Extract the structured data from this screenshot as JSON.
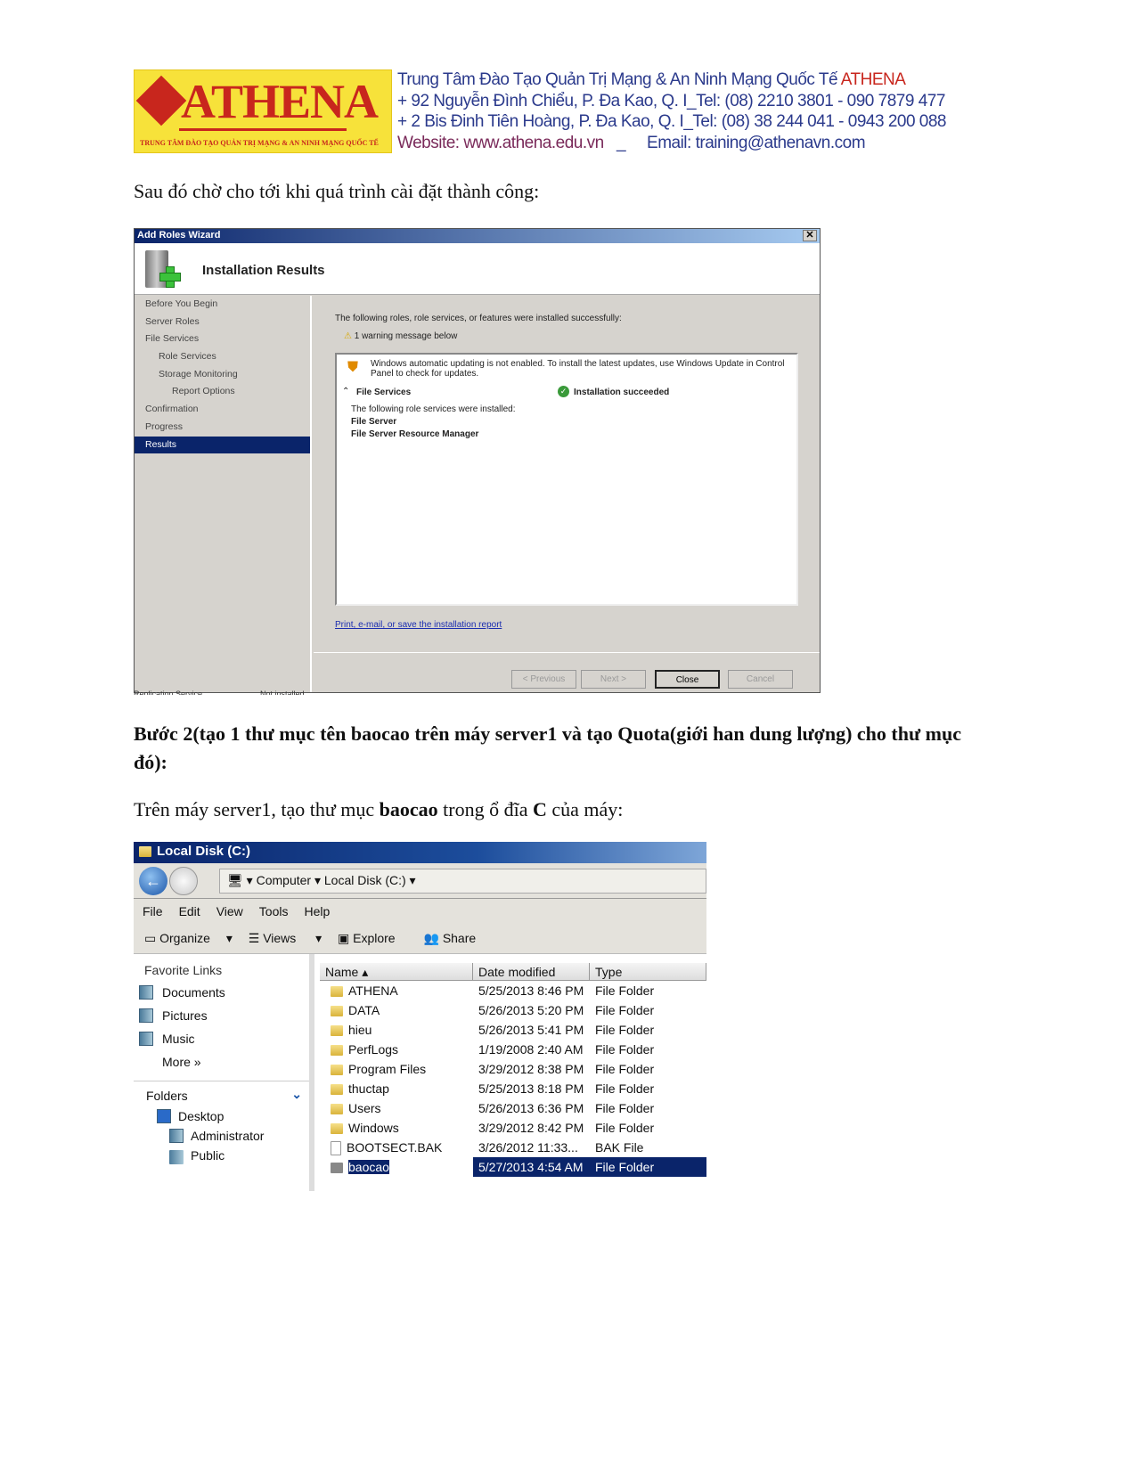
{
  "header": {
    "logo_text": "ATHENA",
    "logo_subtitle": "TRUNG TÂM ĐÀO TẠO QUẢN TRỊ MẠNG & AN NINH MẠNG QUỐC TẾ",
    "line1": "Trung Tâm Đào Tạo Quản Trị Mạng & An Ninh Mạng Quốc Tế ",
    "line1_brand": "ATHENA",
    "line2": "+ 92 Nguyễn Đình Chiểu, P. Đa Kao, Q. I_Tel: (08) 2210 3801 - 090 7879 477",
    "line3": "+ 2 Bis Đinh Tiên Hoàng, P. Đa Kao, Q. I_Tel: (08) 38 244 041 - 0943 200 088",
    "website": "Website: www.athena.edu.vn",
    "sep": "_",
    "email": "Email: training@athenavn.com",
    "colors": {
      "brand_red": "#c8261d",
      "logo_yellow": "#f7e23a",
      "text_blue": "#2b3a8c"
    }
  },
  "para1": "Sau đó chờ cho tới khi quá trình cài đặt thành công:",
  "wizard": {
    "title": "Add Roles Wizard",
    "close": "✕",
    "heading": "Installation Results",
    "nav": [
      "Before You Begin",
      "Server Roles",
      "File Services",
      "Role Services",
      "Storage Monitoring",
      "Report Options",
      "Confirmation",
      "Progress",
      "Results"
    ],
    "selected": "Results",
    "intro": "The following roles, role services, or features were installed successfully:",
    "warning_count": "1 warning message below",
    "warning": "Windows automatic updating is not enabled. To install the latest updates, use Windows Update in Control Panel to check for updates.",
    "section": "File Services",
    "status": "Installation succeeded",
    "installed_label": "The following role services were installed:",
    "installed": [
      "File Server",
      "File Server Resource Manager"
    ],
    "report_link": "Print, e-mail, or save the installation report",
    "buttons": {
      "previous": "< Previous",
      "next": "Next >",
      "close": "Close",
      "cancel": "Cancel"
    },
    "behind_text": [
      "Replication Service",
      "Not installed"
    ]
  },
  "step2": "Bước 2(tạo 1 thư mục tên baocao trên máy server1 và tạo Quota(giới han dung lượng) cho thư mục đó):",
  "para2": {
    "a": "Trên máy server1, tạo thư mục ",
    "b": "baocao",
    "c": " trong ổ đĩa ",
    "d": "C",
    "e": " của máy:"
  },
  "explorer": {
    "title": "Local Disk (C:)",
    "breadcrumb": [
      "Computer",
      "Local Disk (C:)"
    ],
    "menu": [
      "File",
      "Edit",
      "View",
      "Tools",
      "Help"
    ],
    "toolbar": [
      "Organize",
      "Views",
      "Explore",
      "Share"
    ],
    "favorites_title": "Favorite Links",
    "favorites": [
      "Documents",
      "Pictures",
      "Music"
    ],
    "more": "More  »",
    "folders_title": "Folders",
    "tree": [
      "Desktop",
      "Administrator",
      "Public"
    ],
    "columns": [
      "Name",
      "Date modified",
      "Type"
    ],
    "files": [
      {
        "name": "ATHENA",
        "date": "5/25/2013 8:46 PM",
        "type": "File Folder"
      },
      {
        "name": "DATA",
        "date": "5/26/2013 5:20 PM",
        "type": "File Folder"
      },
      {
        "name": "hieu",
        "date": "5/26/2013 5:41 PM",
        "type": "File Folder"
      },
      {
        "name": "PerfLogs",
        "date": "1/19/2008 2:40 AM",
        "type": "File Folder"
      },
      {
        "name": "Program Files",
        "date": "3/29/2012 8:38 PM",
        "type": "File Folder"
      },
      {
        "name": "thuctap",
        "date": "5/25/2013 8:18 PM",
        "type": "File Folder"
      },
      {
        "name": "Users",
        "date": "5/26/2013 6:36 PM",
        "type": "File Folder"
      },
      {
        "name": "Windows",
        "date": "3/29/2012 8:42 PM",
        "type": "File Folder"
      },
      {
        "name": "BOOTSECT.BAK",
        "date": "3/26/2012 11:33...",
        "type": "BAK File"
      },
      {
        "name": "baocao",
        "date": "5/27/2013 4:54 AM",
        "type": "File Folder",
        "selected": true
      }
    ]
  }
}
